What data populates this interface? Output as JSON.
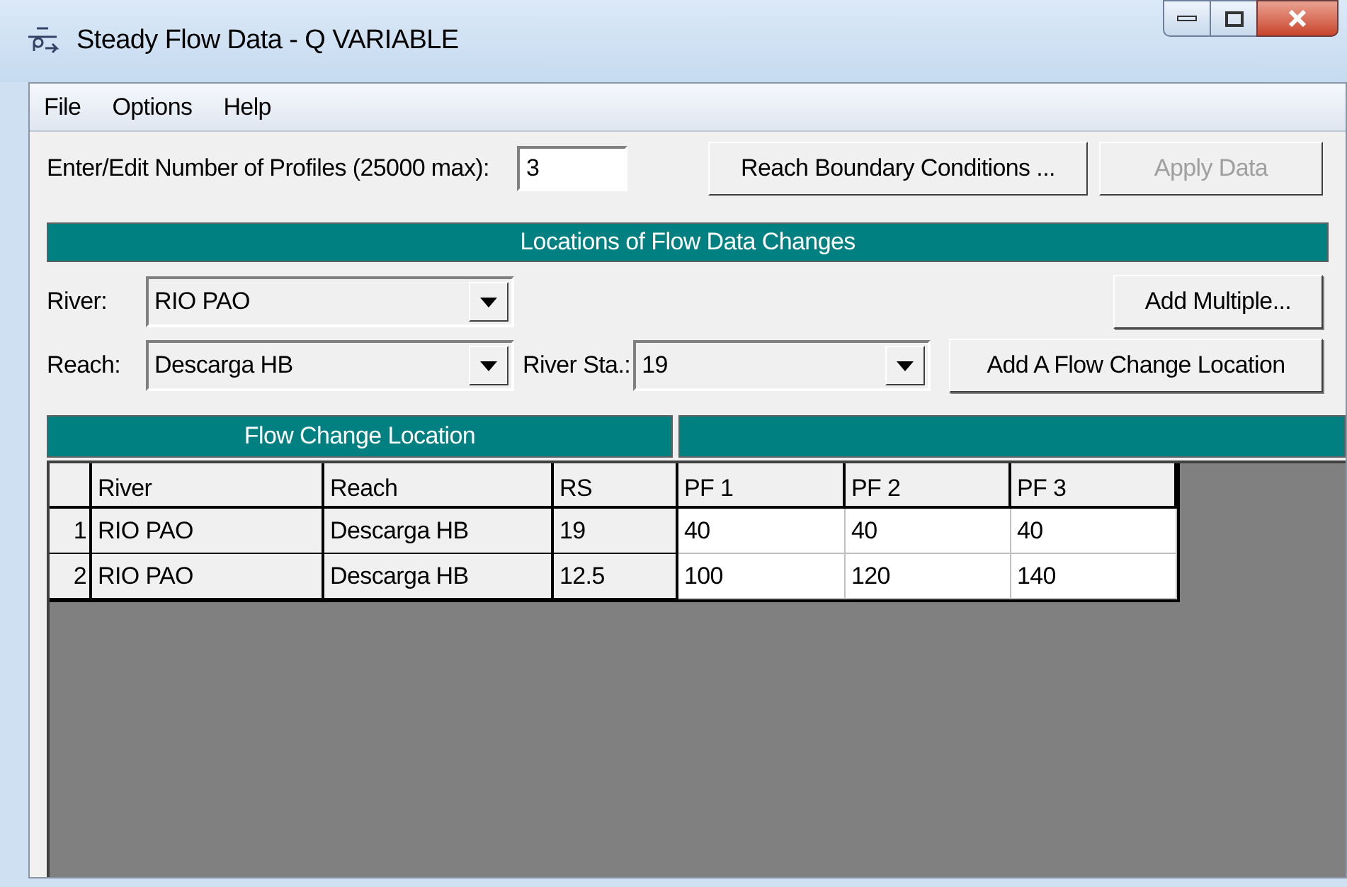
{
  "window": {
    "title": "Steady Flow Data - Q VARIABLE"
  },
  "menu": [
    "File",
    "Options",
    "Help"
  ],
  "profiles": {
    "label": "Enter/Edit Number of Profiles (25000 max):",
    "value": "3"
  },
  "top_buttons": [
    {
      "label": "Reach Boundary Conditions ...",
      "disabled": false
    },
    {
      "label": "Apply Data",
      "disabled": true
    }
  ],
  "locations_header": "Locations of Flow Data Changes",
  "river": {
    "label": "River:",
    "value": "RIO PAO"
  },
  "add_multiple": "Add Multiple...",
  "reach": {
    "label": "Reach:",
    "value": "Descarga HB"
  },
  "river_sta": {
    "label": "River Sta.:",
    "value": "19"
  },
  "add_location": "Add A Flow Change Location",
  "table": {
    "group_header": "Flow Change Location",
    "columns": [
      "River",
      "Reach",
      "RS",
      "PF 1",
      "PF 2",
      "PF 3"
    ],
    "rows": [
      {
        "number": "1",
        "cells": [
          "RIO PAO",
          "Descarga HB",
          "19",
          "40",
          "40",
          "40"
        ]
      },
      {
        "number": "2",
        "cells": [
          "RIO PAO",
          "Descarga HB",
          "12.5",
          "100",
          "120",
          "140"
        ]
      }
    ]
  }
}
